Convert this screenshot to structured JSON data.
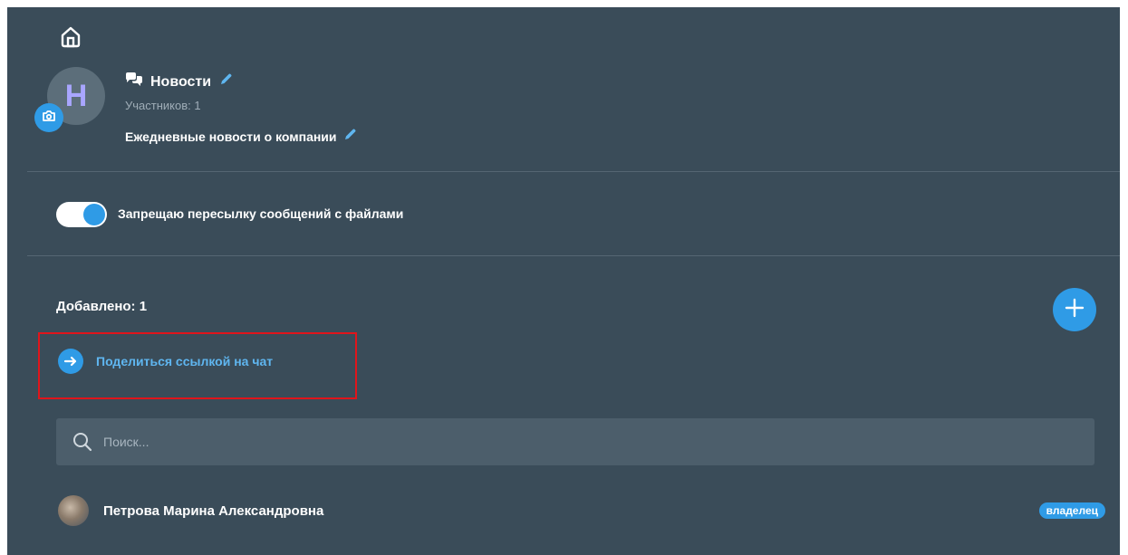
{
  "chat": {
    "title": "Новости",
    "members": "Участников: 1",
    "description": "Ежедневные новости о компании",
    "avatar_letter": "Н"
  },
  "settings": {
    "forward_restriction_label": "Запрещаю пересылку сообщений с файлами",
    "forward_restriction_enabled": true
  },
  "participants": {
    "added_label": "Добавлено: 1",
    "share_link_label": "Поделиться ссылкой на чат",
    "search_placeholder": "Поиск...",
    "list": [
      {
        "name": "Петрова Марина Александровна",
        "role": "владелец"
      }
    ]
  },
  "icons": {
    "home": "home-icon",
    "chat": "chat-bubbles-icon",
    "edit": "pencil-icon",
    "camera": "camera-icon",
    "add": "plus-icon",
    "share": "arrow-right-icon",
    "search": "search-icon"
  },
  "colors": {
    "panel": "#3a4c59",
    "accent": "#2f9be6",
    "highlight_border": "#e0151b",
    "avatar_letter": "#a9a6ff"
  }
}
